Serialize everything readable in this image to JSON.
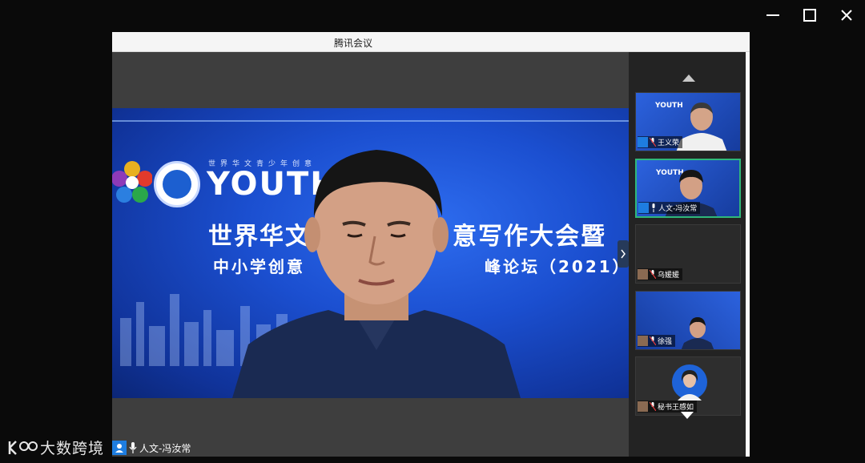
{
  "window": {
    "controls": [
      "minimize",
      "maximize",
      "close"
    ]
  },
  "meeting": {
    "title": "腾讯会议",
    "main_speaker": {
      "name": "人文-冯汝常"
    },
    "banner": {
      "small_line": "世界华文青少年创意",
      "youth": "YOUTH",
      "title_left": "世界华文",
      "title_right": "意写作大会暨",
      "subtitle_left": "中小学创意",
      "subtitle_right": "峰论坛（2021）"
    },
    "participants": [
      {
        "name": "王义荣",
        "video": true
      },
      {
        "name": "人文-冯汝常",
        "video": true,
        "active": true
      },
      {
        "name": "乌媛媛",
        "video": false
      },
      {
        "name": "徐强",
        "video": true
      },
      {
        "name": "秘书王感如",
        "video": true
      }
    ]
  },
  "watermark": {
    "text": "大数跨境"
  },
  "colors": {
    "accent": "#1e7de0",
    "active_border": "#2fb87a",
    "banner_blue": "#1b4fd0"
  }
}
